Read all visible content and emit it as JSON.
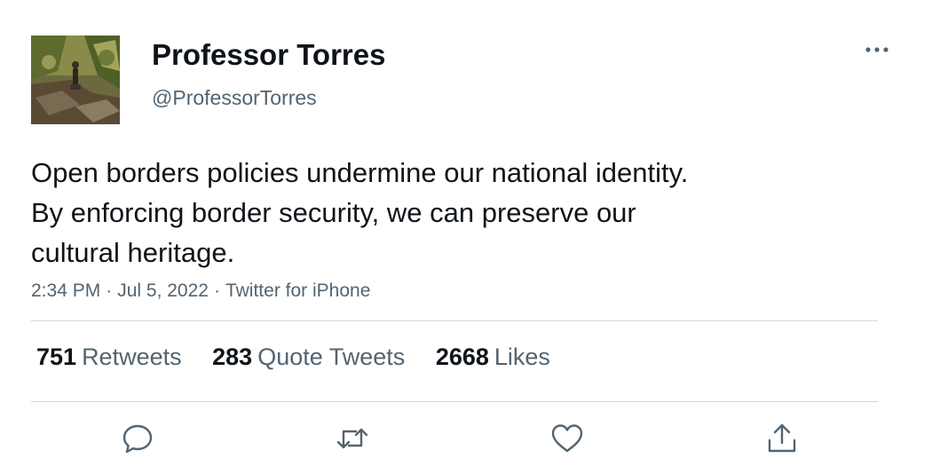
{
  "author": {
    "display_name": "Professor Torres",
    "handle": "@ProfessorTorres",
    "avatar_icon": "profile-photo"
  },
  "tweet": {
    "lines": [
      "Open borders policies undermine our national identity.",
      "By enforcing border security, we can preserve our",
      "cultural heritage."
    ],
    "time": "2:34 PM",
    "separator": "·",
    "date": "Jul 5, 2022",
    "source": "Twitter for iPhone"
  },
  "stats": {
    "retweets": {
      "count": "751",
      "label": "Retweets"
    },
    "quote_tweets": {
      "count": "283",
      "label": "Quote Tweets"
    },
    "likes": {
      "count": "2668",
      "label": "Likes"
    }
  },
  "actions": {
    "reply_icon": "reply-icon",
    "retweet_icon": "retweet-icon",
    "like_icon": "heart-icon",
    "share_icon": "share-icon"
  },
  "colors": {
    "text_primary": "#0f1419",
    "text_secondary": "#536471",
    "divider": "#cfd9de",
    "icon": "#536471"
  }
}
